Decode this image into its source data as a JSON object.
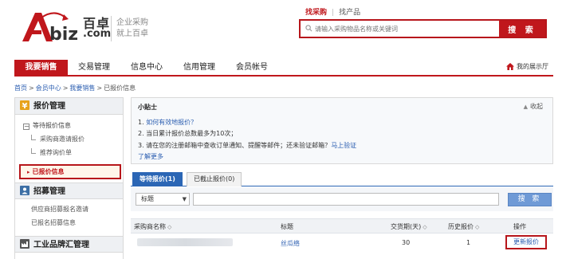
{
  "brand": {
    "name_cn": "百卓",
    "domain": ".com",
    "slogan_1": "企业采购",
    "slogan_2": "就上百卓",
    "accent": "#c0171c"
  },
  "search": {
    "tab_active": "找采购",
    "tab_other": "找产品",
    "placeholder": "请输入采购物品名称或关键词",
    "button": "搜 索"
  },
  "nav": {
    "items": [
      "我要销售",
      "交易管理",
      "信息中心",
      "信用管理",
      "会员帐号"
    ],
    "active_index": 0,
    "my_shop": "我的展示厅"
  },
  "breadcrumb": {
    "home": "首页",
    "member": "会员中心",
    "sell": "我要销售",
    "current": "已报价信息"
  },
  "sidebar": {
    "quote_section": "报价管理",
    "waiting_group": "等待报价信息",
    "leaf_1": "采购商邀请报价",
    "leaf_2": "推荐询价单",
    "active_item": "已报价信息",
    "recruit_section": "招募管理",
    "recruit_1": "供应商招募报名邀请",
    "recruit_2": "已报名招募信息",
    "brand_section": "工业品牌汇管理"
  },
  "tips": {
    "title": "小贴士",
    "collapse": "收起",
    "line1_prefix": "1.",
    "line1_link": "如何有效地报价？",
    "line2": "2. 当日累计报价总数最多为10次；",
    "line3_text": "3. 请在您的注册邮箱中查收订单通知、提醒等邮件；还未验证邮箱？",
    "line3_link": "马上验证",
    "more": "了解更多"
  },
  "tabs": {
    "tab1": "等待报价(1)",
    "tab2": "已截止报价(0)"
  },
  "filter": {
    "field": "标题",
    "button": "搜 索"
  },
  "table": {
    "headers": {
      "supplier": "采购商名称",
      "title": "标题",
      "delivery": "交货期(天)",
      "history": "历史报价",
      "action": "操作"
    },
    "rows": [
      {
        "title": "丝瓜络",
        "delivery": "30",
        "history": "1",
        "action": "更新报价"
      }
    ]
  }
}
